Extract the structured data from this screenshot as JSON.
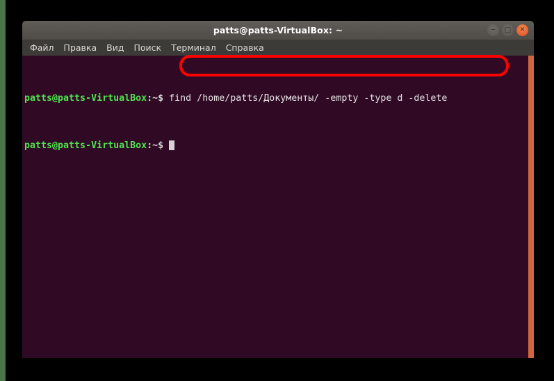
{
  "window": {
    "title": "patts@patts-VirtualBox: ~",
    "controls": [
      {
        "name": "minimize",
        "glyph": "–"
      },
      {
        "name": "maximize",
        "glyph": "□"
      },
      {
        "name": "close",
        "glyph": "✕"
      }
    ]
  },
  "menubar": {
    "items": [
      {
        "label": "Файл"
      },
      {
        "label": "Правка"
      },
      {
        "label": "Вид"
      },
      {
        "label": "Поиск"
      },
      {
        "label": "Терминал"
      },
      {
        "label": "Справка"
      }
    ]
  },
  "terminal": {
    "lines": [
      {
        "user_host": "patts@patts-VirtualBox",
        "path": ":~",
        "dollar": "$ ",
        "command": "find /home/patts/Документы/ -empty -type d -delete"
      },
      {
        "user_host": "patts@patts-VirtualBox",
        "path": ":~",
        "dollar": "$ ",
        "command": ""
      }
    ]
  },
  "annotation": {
    "shape": "rounded-rectangle",
    "color": "#ff0000",
    "targets_text": "find /home/patts/Документы/ -empty -type d -delete"
  },
  "colors": {
    "terminal_background": "#300a24",
    "prompt_green": "#4ee44e",
    "titlebar": "#57534e",
    "menubar": "#3d3b38",
    "scrollbar": "#d1663a",
    "desktop_green": "#4c7449",
    "annotation_red": "#ff0000"
  }
}
